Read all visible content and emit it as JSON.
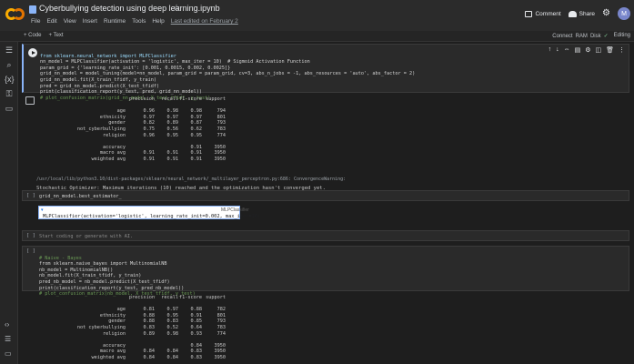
{
  "app": {
    "title": "Cyberbullying detection using deep learning.ipynb",
    "menu": [
      "File",
      "Edit",
      "View",
      "Insert",
      "Runtime",
      "Tools",
      "Help"
    ],
    "last_edit": "Last edited on February 2",
    "comment": "Comment",
    "share": "Share",
    "avatar": "M"
  },
  "toolbar": {
    "code": "+ Code",
    "text": "+ Text",
    "connect": "Connect",
    "ram": "RAM",
    "disk": "Disk",
    "status": "✓",
    "editing": "Editing"
  },
  "cells": {
    "c1": {
      "code": [
        "from sklearn.neural_network import MLPClassifier",
        "nn_model = MLPClassifier(activation = 'logistic', max_iter = 10)  # Sigmoid Activation Function",
        "param_grid = {'learning_rate_init': [0.001, 0.0015, 0.002, 0.0025]}",
        "grid_nn_model = model_tuning(model=nn_model, param_grid = param_grid, cv=3, abs_n_jobs = -1, abs_resources = 'auto', abs_factor = 2)",
        "grid_nn_model.fit(X_train_tfidf, y_train)",
        "pred = grid_nn_model.predict(X_test_tfidf)",
        "print(classification_report(y_test, pred, grid_nn_model))",
        "# plot_confusion_matrix(grid_nn_model, X_test_tfidf, y_test)"
      ],
      "report": {
        "header": [
          "precision",
          "recall",
          "f1-score",
          "support"
        ],
        "rows": [
          [
            "age",
            "0.96",
            "0.98",
            "0.98",
            "794"
          ],
          [
            "ethnicity",
            "0.97",
            "0.97",
            "0.97",
            "801"
          ],
          [
            "gender",
            "0.82",
            "0.89",
            "0.87",
            "793"
          ],
          [
            "not_cyberbullying",
            "0.75",
            "0.56",
            "0.62",
            "783"
          ],
          [
            "religion",
            "0.96",
            "0.95",
            "0.95",
            "774"
          ]
        ],
        "summary": [
          [
            "accuracy",
            "",
            "",
            "0.91",
            "3950"
          ],
          [
            "macro avg",
            "0.91",
            "0.91",
            "0.91",
            "3950"
          ],
          [
            "weighted avg",
            "0.91",
            "0.91",
            "0.91",
            "3950"
          ]
        ]
      },
      "warning": "/usr/local/lib/python3.10/dist-packages/sklearn/neural_network/_multilayer_perceptron.py:686: ConvergenceWarning:",
      "warning2": "Stochastic Optimizer: Maximum iterations (10) reached and the optimization hasn't converged yet."
    },
    "c2": {
      "bracket": "[ ]",
      "code": "grid_nn_model.best_estimator_",
      "tip_title": "MLPClassifier",
      "tip_value": "MLPClassifier(activation='logistic', learning_rate_init=0.002, max_iter=10)"
    },
    "c3": {
      "bracket": "[ ]",
      "code": "Start coding or generate with AI."
    },
    "c4": {
      "bracket": "[ ]",
      "code": [
        "# Naive - Bayes",
        "from sklearn.naive_bayes import MultinomialNB",
        "nb_model = MultinomialNB()",
        "nb_model.fit(X_train_tfidf, y_train)",
        "pred_nb_model = nb_model.predict(X_test_tfidf)",
        "print(classification_report(y_test, pred_nb_model))",
        "# plot_confusion_matrix(nb_model, X_test_tfidf, y_test)"
      ],
      "report": {
        "header": [
          "precision",
          "recall",
          "f1-score",
          "support"
        ],
        "rows": [
          [
            "age",
            "0.81",
            "0.97",
            "0.88",
            "782"
          ],
          [
            "ethnicity",
            "0.88",
            "0.95",
            "0.91",
            "801"
          ],
          [
            "gender",
            "0.88",
            "0.83",
            "0.85",
            "793"
          ],
          [
            "not cyberbullying",
            "0.83",
            "0.52",
            "0.64",
            "783"
          ],
          [
            "religion",
            "0.89",
            "0.98",
            "0.93",
            "774"
          ]
        ],
        "summary": [
          [
            "accuracy",
            "",
            "",
            "0.84",
            "3950"
          ],
          [
            "macro avg",
            "0.84",
            "0.84",
            "0.83",
            "3950"
          ],
          [
            "weighted avg",
            "0.84",
            "0.84",
            "0.83",
            "3950"
          ]
        ]
      }
    }
  }
}
